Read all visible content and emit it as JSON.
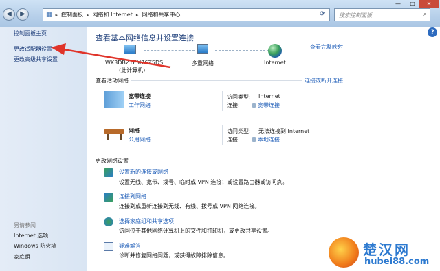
{
  "window": {
    "minimize": "—",
    "maximize": "□",
    "close": "✕"
  },
  "address": {
    "crumbs": [
      "控制面板",
      "网络和 Internet",
      "网络和共享中心"
    ],
    "separator": "▸"
  },
  "search": {
    "placeholder": "搜索控制面板"
  },
  "sidebar": {
    "home": "控制面板主页",
    "adapter": "更改适配器设置",
    "sharing": "更改高级共享设置",
    "see_also": "另请参阅",
    "internet_options": "Internet 选项",
    "firewall": "Windows 防火墙",
    "homegroup": "家庭组"
  },
  "main": {
    "title": "查看基本网络信息并设置连接",
    "full_map": "查看完整映射",
    "map": {
      "computer": "WK3DBZTEM76Z5DS",
      "computer_sub": "(此计算机)",
      "multi": "多重网络",
      "internet": "Internet"
    },
    "active_label": "查看活动网络",
    "connect_link": "连接或断开连接",
    "networks": [
      {
        "name": "宽带连接",
        "type": "工作网络",
        "access_label": "访问类型:",
        "access_value": "Internet",
        "conn_label": "连接:",
        "conn_value": "宽带连接"
      },
      {
        "name": "网络",
        "type": "公用网络",
        "access_label": "访问类型:",
        "access_value": "无法连接到 Internet",
        "conn_label": "连接:",
        "conn_value": "本地连接"
      }
    ],
    "change_label": "更改网络设置",
    "tasks": [
      {
        "title": "设置新的连接或网络",
        "desc": "设置无线、宽带、拨号、临时或 VPN 连接；或设置路由器或访问点。"
      },
      {
        "title": "连接到网络",
        "desc": "连接到或重新连接到无线、有线、拨号或 VPN 网络连接。"
      },
      {
        "title": "选择家庭组和共享选项",
        "desc": "访问位于其他网络计算机上的文件和打印机，或更改共享设置。"
      },
      {
        "title": "疑难解答",
        "desc": "诊断并修复网络问题，或获得故障排除信息。"
      }
    ]
  },
  "watermark": {
    "title": "楚汉网",
    "site": "hubei88.com"
  },
  "colors": {
    "arrow": "#e0342a",
    "link": "#1f5eb8",
    "sidebar": "#dfe8f4"
  }
}
